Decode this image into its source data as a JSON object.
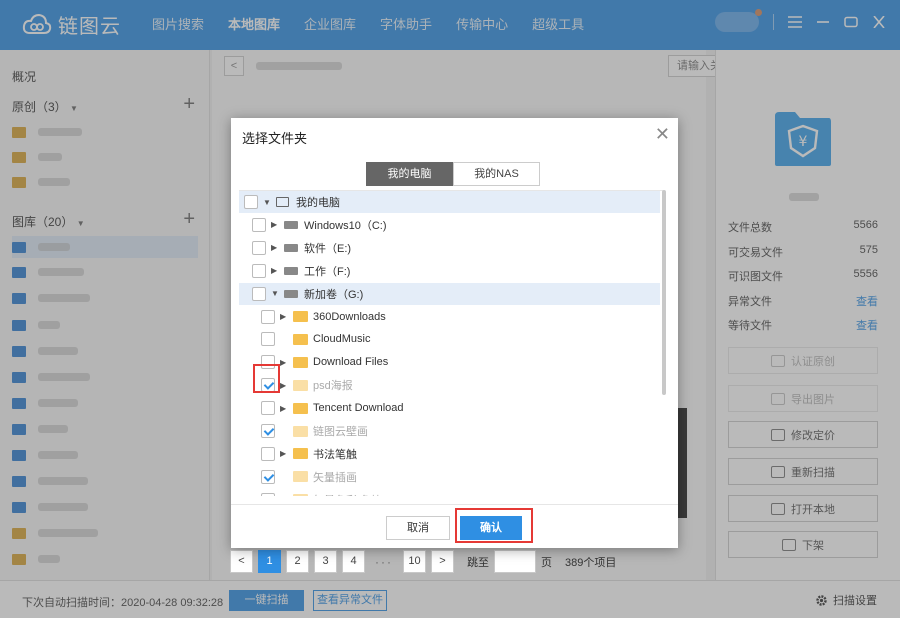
{
  "app": {
    "name": "链图云"
  },
  "nav": [
    {
      "label": "图片搜索",
      "active": false
    },
    {
      "label": "本地图库",
      "active": true
    },
    {
      "label": "企业图库",
      "active": false
    },
    {
      "label": "字体助手",
      "active": false
    },
    {
      "label": "传输中心",
      "active": false
    },
    {
      "label": "超级工具",
      "active": false
    }
  ],
  "sidebar": {
    "overview": "概况",
    "original": "原创（3）",
    "library": "图库（20）"
  },
  "search": {
    "placeholder": "请输入关键字搜索"
  },
  "stats": [
    {
      "label": "文件总数",
      "value": "5566"
    },
    {
      "label": "可交易文件",
      "value": "575"
    },
    {
      "label": "可识图文件",
      "value": "5556"
    },
    {
      "label": "异常文件",
      "value": "查看"
    },
    {
      "label": "等待文件",
      "value": "查看"
    }
  ],
  "actions": [
    {
      "label": "认证原创",
      "icon": "plus-circle-icon",
      "dim": true
    },
    {
      "label": "导出图片",
      "icon": "export-icon",
      "dim": true
    },
    {
      "label": "修改定价",
      "icon": "yen-icon",
      "dim": false
    },
    {
      "label": "重新扫描",
      "icon": "scan-icon",
      "dim": false
    },
    {
      "label": "打开本地",
      "icon": "folder-open-icon",
      "dim": false
    },
    {
      "label": "下架",
      "icon": "takedown-icon",
      "dim": false
    }
  ],
  "pager": {
    "pages": [
      "1",
      "2",
      "3",
      "4"
    ],
    "dots": "···",
    "last": "10",
    "jump": "跳至",
    "unit": "页",
    "total": "389个项目"
  },
  "status": {
    "text": "下次自动扫描时间：2020-04-28 09:32:28",
    "scan_button": "一键扫描",
    "abnormal_button": "查看异常文件",
    "settings": "扫描设置"
  },
  "dialog": {
    "title": "选择文件夹",
    "tabs": [
      "我的电脑",
      "我的NAS"
    ],
    "cancel": "取消",
    "confirm": "确认",
    "tree": [
      {
        "label": "我的电脑",
        "level": 0,
        "icon": "computer-icon",
        "arrow": "down",
        "checked": false,
        "highlight": true,
        "dim": false
      },
      {
        "label": "Windows10（C:)",
        "level": 1,
        "icon": "drive-icon",
        "arrow": "right",
        "checked": false,
        "highlight": false,
        "dim": false
      },
      {
        "label": "软件（E:)",
        "level": 1,
        "icon": "drive-icon",
        "arrow": "right",
        "checked": false,
        "highlight": false,
        "dim": false
      },
      {
        "label": "工作（F:)",
        "level": 1,
        "icon": "drive-icon",
        "arrow": "right",
        "checked": false,
        "highlight": false,
        "dim": false
      },
      {
        "label": "新加卷（G:)",
        "level": 1,
        "icon": "drive-icon",
        "arrow": "down",
        "checked": false,
        "highlight": true,
        "dim": false
      },
      {
        "label": "360Downloads",
        "level": 2,
        "icon": "folder-icon",
        "arrow": "right",
        "checked": false,
        "highlight": false,
        "dim": false
      },
      {
        "label": "CloudMusic",
        "level": 2,
        "icon": "folder-icon",
        "arrow": "",
        "checked": false,
        "highlight": false,
        "dim": false
      },
      {
        "label": "Download Files",
        "level": 2,
        "icon": "folder-icon",
        "arrow": "right",
        "checked": false,
        "highlight": false,
        "dim": false
      },
      {
        "label": "psd海报",
        "level": 2,
        "icon": "folder-icon",
        "arrow": "right",
        "checked": true,
        "highlight": false,
        "dim": true
      },
      {
        "label": "Tencent Download",
        "level": 2,
        "icon": "folder-icon",
        "arrow": "right",
        "checked": false,
        "highlight": false,
        "dim": false
      },
      {
        "label": "链图云壁画",
        "level": 2,
        "icon": "folder-icon",
        "arrow": "",
        "checked": true,
        "highlight": false,
        "dim": true
      },
      {
        "label": "书法笔触",
        "level": 2,
        "icon": "folder-icon",
        "arrow": "right",
        "checked": false,
        "highlight": false,
        "dim": false
      },
      {
        "label": "矢量插画",
        "level": 2,
        "icon": "folder-icon",
        "arrow": "",
        "checked": true,
        "highlight": false,
        "dim": true
      },
      {
        "label": "矢量色彩 色块",
        "level": 2,
        "icon": "folder-icon",
        "arrow": "",
        "checked": true,
        "highlight": false,
        "dim": true
      }
    ]
  },
  "colors": {
    "accent": "#2f8fe3",
    "folder": "#f5c04e",
    "marker": "#e53935"
  }
}
